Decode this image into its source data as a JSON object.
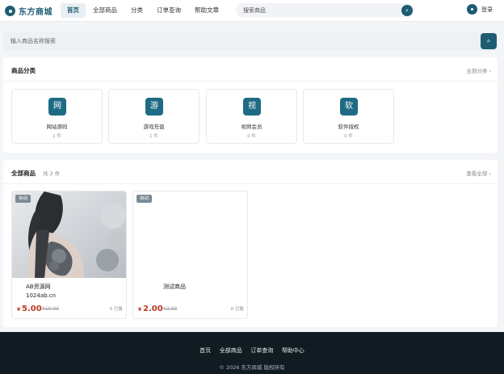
{
  "header": {
    "logo_text": "东方商城",
    "nav": [
      {
        "label": "首页",
        "active": true
      },
      {
        "label": "全部商品",
        "active": false
      },
      {
        "label": "分类",
        "active": false
      },
      {
        "label": "订单查询",
        "active": false
      },
      {
        "label": "帮助文章",
        "active": false
      }
    ],
    "search_placeholder": "搜索商品",
    "search_icon": "search-icon",
    "login_label": "登录"
  },
  "sub_search": {
    "placeholder": "输入商品名称搜索",
    "icon": "search-icon"
  },
  "categories": {
    "title": "商品分类",
    "more": "全部分类 ›",
    "items": [
      {
        "icon_char": "网",
        "name": "网站源码",
        "count": "1 件"
      },
      {
        "icon_char": "游",
        "name": "游戏充值",
        "count": "1 件"
      },
      {
        "icon_char": "视",
        "name": "视频会员",
        "count": "0 件"
      },
      {
        "icon_char": "软",
        "name": "软件授权",
        "count": "0 件"
      }
    ]
  },
  "products": {
    "title": "全部商品",
    "count": "共 2 件",
    "more": "查看全部 ›",
    "items": [
      {
        "badge": "自动",
        "title": "AB资源网\n1024ab.cn",
        "currency": "¥",
        "price": "5.00",
        "old_price": "¥10.00",
        "sold": "0 已售",
        "has_image": true
      },
      {
        "badge": "自动",
        "title": "测试商品",
        "currency": "¥",
        "price": "2.00",
        "old_price": "¥3.00",
        "sold": "0 已售",
        "has_image": false
      }
    ]
  },
  "footer": {
    "links": [
      "首页",
      "全部商品",
      "订单查询",
      "帮助中心"
    ],
    "copyright": "© 2026 东方商城 版权所有"
  },
  "colors": {
    "brand": "#1d5c73",
    "price": "#b83a21",
    "footer_bg": "#111b22"
  }
}
